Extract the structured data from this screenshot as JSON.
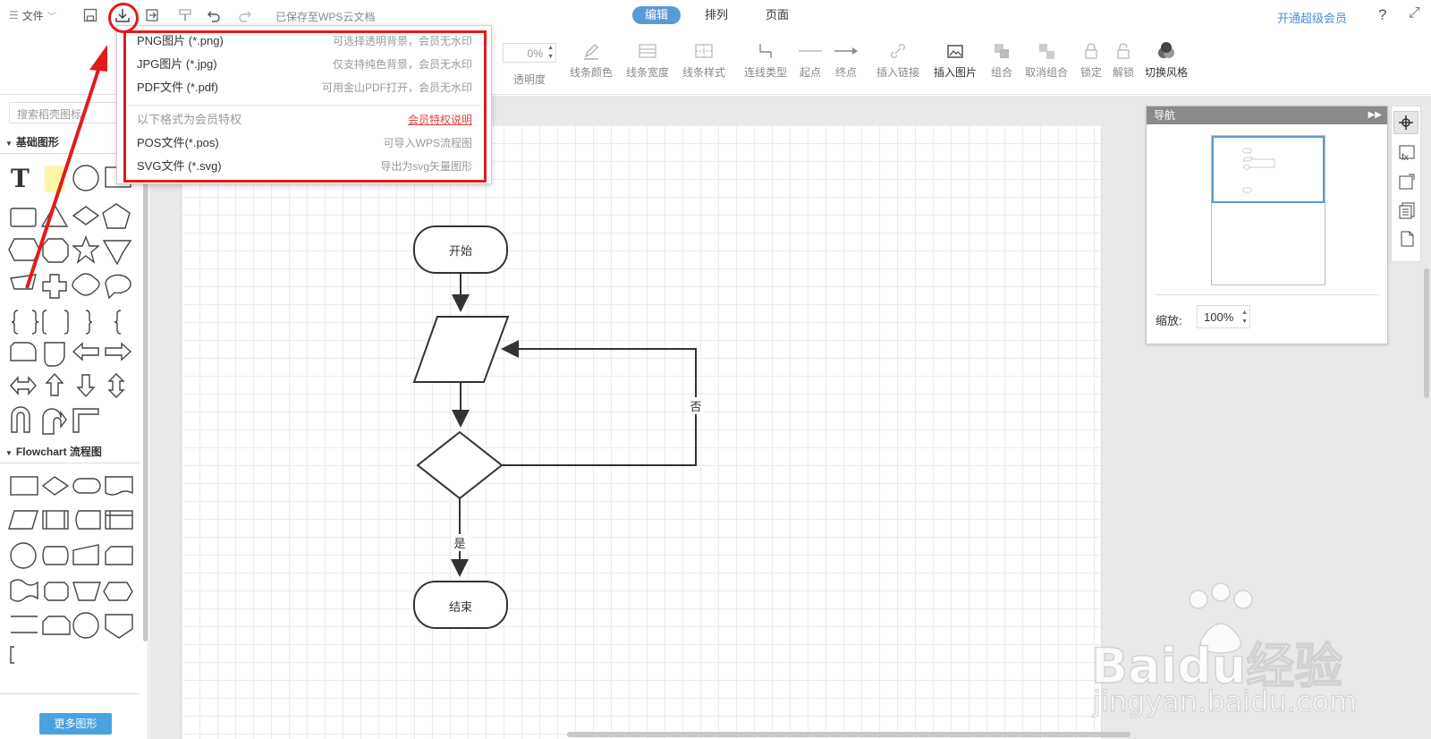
{
  "topbar": {
    "file_menu": "文件",
    "save_status": "已保存至WPS云文档",
    "tabs": [
      "编辑",
      "排列",
      "页面"
    ],
    "vip_link": "开通超级会员",
    "help": "?"
  },
  "toolbar": {
    "opacity_value": "0%",
    "tools": [
      {
        "label": "透明度"
      },
      {
        "label": "线条颜色"
      },
      {
        "label": "线条宽度"
      },
      {
        "label": "线条样式"
      },
      {
        "label": "连线类型"
      },
      {
        "label": "起点"
      },
      {
        "label": "终点"
      },
      {
        "label": "插入链接"
      },
      {
        "label": "插入图片"
      },
      {
        "label": "组合"
      },
      {
        "label": "取消组合"
      },
      {
        "label": "锁定"
      },
      {
        "label": "解锁"
      },
      {
        "label": "切换风格"
      }
    ]
  },
  "leftpanel": {
    "search_placeholder": "搜索稻壳图标",
    "section_basic": "基础图形",
    "section_flowchart": "Flowchart 流程图",
    "more_button": "更多图形"
  },
  "dropdown": {
    "items": [
      {
        "left": "PNG图片 (*.png)",
        "right": "可选择透明背景，会员无水印"
      },
      {
        "left": "JPG图片 (*.jpg)",
        "right": "仅支持纯色背景，会员无水印"
      },
      {
        "left": "PDF文件 (*.pdf)",
        "right": "可用金山PDF打开，会员无水印"
      },
      {
        "left": "以下格式为会员特权",
        "right": "会员特权说明"
      },
      {
        "left": "POS文件(*.pos)",
        "right": "可导入WPS流程图"
      },
      {
        "left": "SVG文件 (*.svg)",
        "right": "导出为svg矢量图形"
      }
    ]
  },
  "flowchart": {
    "start": "开始",
    "end": "结束",
    "no_label": "否",
    "yes_label": "是"
  },
  "navigator": {
    "title": "导航",
    "zoom_label": "缩放:",
    "zoom_value": "100%"
  },
  "watermark": {
    "brand": "Baidu经验",
    "url": "jingyan.baidu.com"
  },
  "colors": {
    "accent": "#5b9bd5",
    "highlight_red": "#e21b1b",
    "more_button": "#4aa3e0"
  }
}
